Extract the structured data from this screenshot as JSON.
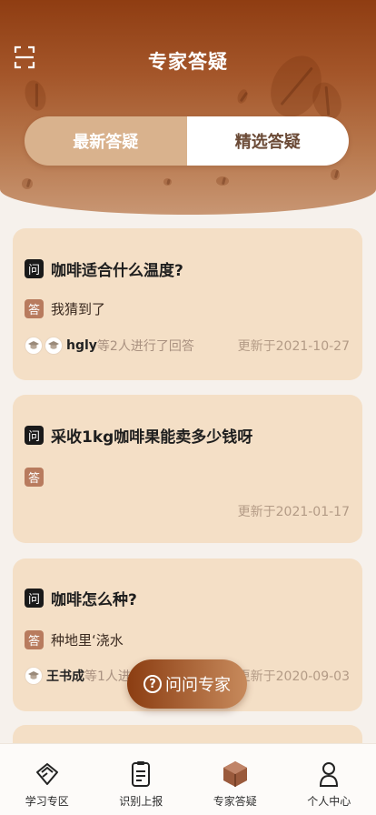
{
  "header": {
    "title": "专家答疑"
  },
  "tabs": [
    {
      "label": "最新答疑",
      "active": true
    },
    {
      "label": "精选答疑",
      "active": false
    }
  ],
  "questions": [
    {
      "q_badge": "问",
      "question": "咖啡适合什么温度?",
      "a_badge": "答",
      "answer": "我猜到了",
      "answerer": "hgly",
      "answer_count": "等2人进行了回答",
      "updated": "更新于2021-10-27"
    },
    {
      "q_badge": "问",
      "question": "采收1kg咖啡果能卖多少钱呀",
      "a_badge": "答",
      "answer": "",
      "updated": "更新于2021-01-17"
    },
    {
      "q_badge": "问",
      "question": "咖啡怎么种?",
      "a_badge": "答",
      "answer": "种地里‘浇水",
      "answerer": "王书成",
      "answer_count": "等1人进",
      "updated": "更新于2020-09-03"
    }
  ],
  "ask_button": {
    "icon": "?",
    "label": "问问专家"
  },
  "bottom_nav": [
    {
      "label": "学习专区",
      "icon": "book-icon"
    },
    {
      "label": "识别上报",
      "icon": "report-icon"
    },
    {
      "label": "专家答疑",
      "icon": "expert-qa-icon",
      "active": true
    },
    {
      "label": "个人中心",
      "icon": "person-icon"
    }
  ],
  "colors": {
    "header_dark": "#8f3d12",
    "card_bg": "#f4dfc6",
    "tab_active_bg": "#d9b28d",
    "answer_badge": "#b87b5e"
  }
}
